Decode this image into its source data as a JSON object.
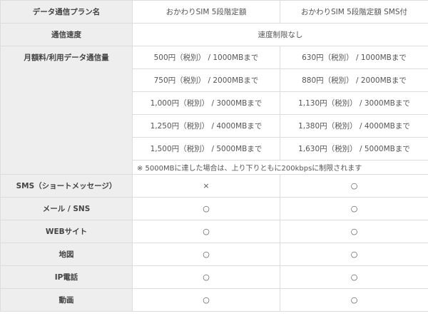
{
  "header": {
    "label": "データ通信プラン名",
    "plan_a": "おかわりSIM 5段階定額",
    "plan_b": "おかわりSIM 5段階定額 SMS付"
  },
  "speed": {
    "label": "通信速度",
    "value": "速度制限なし"
  },
  "fees": {
    "label": "月額料/利用データ通信量",
    "rows": [
      {
        "a": "500円（税別） / 1000MBまで",
        "b": "630円（税別） / 1000MBまで"
      },
      {
        "a": "750円（税別） / 2000MBまで",
        "b": "880円（税別） / 2000MBまで"
      },
      {
        "a": "1,000円（税別） / 3000MBまで",
        "b": "1,130円（税別） / 3000MBまで"
      },
      {
        "a": "1,250円（税別） / 4000MBまで",
        "b": "1,380円（税別） / 4000MBまで"
      },
      {
        "a": "1,500円（税別） / 5000MBまで",
        "b": "1,630円（税別） / 5000MBまで"
      }
    ],
    "note": "※ 5000MBに達した場合は、上り下りともに200kbpsに制限されます"
  },
  "features": [
    {
      "label": "SMS（ショートメッセージ）",
      "a": "×",
      "b": "○"
    },
    {
      "label": "メール / SNS",
      "a": "○",
      "b": "○"
    },
    {
      "label": "WEBサイト",
      "a": "○",
      "b": "○"
    },
    {
      "label": "地図",
      "a": "○",
      "b": "○"
    },
    {
      "label": "IP電話",
      "a": "○",
      "b": "○"
    },
    {
      "label": "動画",
      "a": "○",
      "b": "○"
    }
  ]
}
